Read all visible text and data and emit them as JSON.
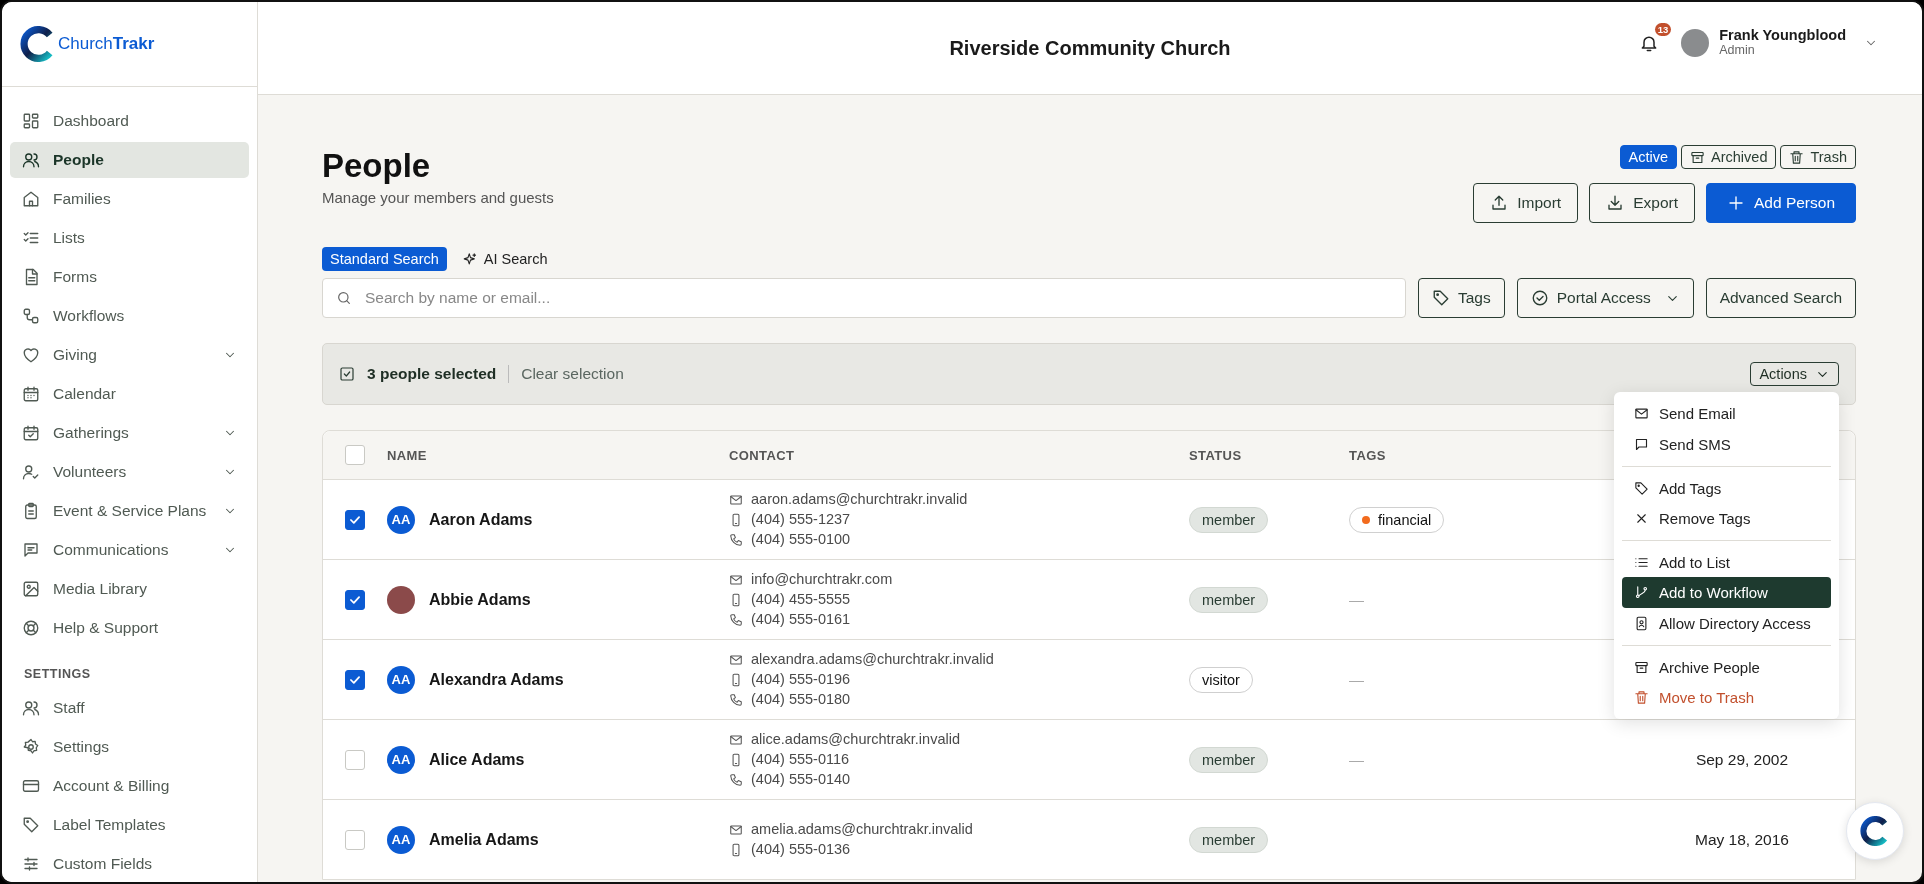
{
  "app": {
    "logo_text": "Church**Trakr**",
    "org_name": "Riverside Community Church"
  },
  "notifications": {
    "count": "13"
  },
  "user": {
    "name": "Frank Youngblood",
    "role": "Admin"
  },
  "sidebar": {
    "items": [
      {
        "label": "Dashboard",
        "selected": false,
        "expandable": false
      },
      {
        "label": "People",
        "selected": true,
        "expandable": false
      },
      {
        "label": "Families",
        "selected": false,
        "expandable": false
      },
      {
        "label": "Lists",
        "selected": false,
        "expandable": false
      },
      {
        "label": "Forms",
        "selected": false,
        "expandable": false
      },
      {
        "label": "Workflows",
        "selected": false,
        "expandable": false
      },
      {
        "label": "Giving",
        "selected": false,
        "expandable": true
      },
      {
        "label": "Calendar",
        "selected": false,
        "expandable": false
      },
      {
        "label": "Gatherings",
        "selected": false,
        "expandable": true
      },
      {
        "label": "Volunteers",
        "selected": false,
        "expandable": true
      },
      {
        "label": "Event & Service Plans",
        "selected": false,
        "expandable": true
      },
      {
        "label": "Communications",
        "selected": false,
        "expandable": true
      },
      {
        "label": "Media Library",
        "selected": false,
        "expandable": false
      },
      {
        "label": "Help & Support",
        "selected": false,
        "expandable": false
      }
    ],
    "settings_heading": "SETTINGS",
    "settings_items": [
      {
        "label": "Staff",
        "selected": false
      },
      {
        "label": "Settings",
        "selected": false
      },
      {
        "label": "Account & Billing",
        "selected": false
      },
      {
        "label": "Label Templates",
        "selected": false
      },
      {
        "label": "Custom Fields",
        "selected": false
      }
    ]
  },
  "page": {
    "title": "People",
    "subtitle": "Manage your members and guests",
    "view_tabs": [
      {
        "label": "Active",
        "selected": true
      },
      {
        "label": "Archived",
        "selected": false
      },
      {
        "label": "Trash",
        "selected": false
      }
    ],
    "buttons": [
      {
        "label": "Import",
        "kind": "outline"
      },
      {
        "label": "Export",
        "kind": "outline"
      },
      {
        "label": "Add Person",
        "kind": "primary"
      }
    ]
  },
  "search": {
    "modes": [
      {
        "label": "Standard Search",
        "selected": true
      },
      {
        "label": "AI Search",
        "selected": false
      }
    ],
    "placeholder": "Search by name or email...",
    "filters": [
      {
        "label": "Tags",
        "dropdown": false
      },
      {
        "label": "Portal Access",
        "dropdown": true
      },
      {
        "label": "Advanced Search",
        "dropdown": false
      }
    ]
  },
  "selection_bar": {
    "count_text": "3 people selected",
    "clear": "Clear selection",
    "actions": "Actions"
  },
  "actions_menu": {
    "items": [
      {
        "label": "Send Email",
        "kind": "normal",
        "selected": false,
        "divider_before": false
      },
      {
        "label": "Send SMS",
        "kind": "normal",
        "selected": false,
        "divider_before": false
      },
      {
        "label": "Add Tags",
        "kind": "normal",
        "selected": false,
        "divider_before": true
      },
      {
        "label": "Remove Tags",
        "kind": "normal",
        "selected": false,
        "divider_before": false
      },
      {
        "label": "Add to List",
        "kind": "normal",
        "selected": false,
        "divider_before": true
      },
      {
        "label": "Add to Workflow",
        "kind": "normal",
        "selected": true,
        "divider_before": false
      },
      {
        "label": "Allow Directory Access",
        "kind": "normal",
        "selected": false,
        "divider_before": false
      },
      {
        "label": "Archive People",
        "kind": "normal",
        "selected": false,
        "divider_before": true
      },
      {
        "label": "Move to Trash",
        "kind": "danger",
        "selected": false,
        "divider_before": false
      }
    ]
  },
  "table": {
    "all_checked": false,
    "columns": [
      "NAME",
      "CONTACT",
      "STATUS",
      "TAGS"
    ],
    "rows": [
      {
        "checked": true,
        "avatar": {
          "kind": "initials",
          "text": "AA"
        },
        "name": "Aaron Adams",
        "email": "aaron.adams@churchtrakr.invalid",
        "mobile": "(404) 555-1237",
        "phone": "(404) 555-0100",
        "status": {
          "label": "member",
          "kind": "filled"
        },
        "tags": [
          {
            "label": "financial",
            "color": "#f26b1d"
          }
        ]
      },
      {
        "checked": true,
        "avatar": {
          "kind": "photo"
        },
        "name": "Abbie Adams",
        "email": "info@churchtrakr.com",
        "mobile": "(404) 455-5555",
        "phone": "(404) 555-0161",
        "status": {
          "label": "member",
          "kind": "filled"
        },
        "tag_text": "—"
      },
      {
        "checked": true,
        "avatar": {
          "kind": "initials",
          "text": "AA"
        },
        "name": "Alexandra Adams",
        "email": "alexandra.adams@churchtrakr.invalid",
        "mobile": "(404) 555-0196",
        "phone": "(404) 555-0180",
        "status": {
          "label": "visitor",
          "kind": "outline"
        },
        "tag_text": "—"
      },
      {
        "checked": false,
        "avatar": {
          "kind": "initials",
          "text": "AA"
        },
        "name": "Alice Adams",
        "email": "alice.adams@churchtrakr.invalid",
        "mobile": "(404) 555-0116",
        "phone": "(404) 555-0140",
        "status": {
          "label": "member",
          "kind": "filled"
        },
        "tag_text": "—",
        "column_5": "Sep 29, 2002"
      },
      {
        "checked": false,
        "avatar": {
          "kind": "initials",
          "text": "AA"
        },
        "name": "Amelia Adams",
        "email": "amelia.adams@churchtrakr.invalid",
        "mobile": "(404) 555-0136",
        "status": {
          "label": "member",
          "kind": "filled"
        },
        "column_5": "May 18, 2016"
      }
    ]
  }
}
